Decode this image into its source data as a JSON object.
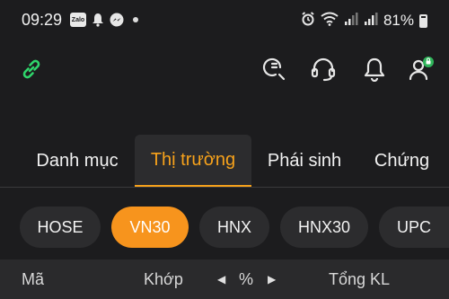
{
  "status_bar": {
    "time": "09:29",
    "zalo_label": "Zalo",
    "battery": "81%"
  },
  "tabs": [
    {
      "label": "Danh mục",
      "active": false
    },
    {
      "label": "Thị trường",
      "active": true
    },
    {
      "label": "Phái sinh",
      "active": false
    },
    {
      "label": "Chứng",
      "active": false
    }
  ],
  "exchanges": [
    {
      "label": "HOSE",
      "active": false
    },
    {
      "label": "VN30",
      "active": true
    },
    {
      "label": "HNX",
      "active": false
    },
    {
      "label": "HNX30",
      "active": false
    },
    {
      "label": "UPC",
      "active": false
    }
  ],
  "table_header": {
    "code": "Mã",
    "match": "Khớp",
    "percent": "%",
    "total_volume": "Tổng KL"
  },
  "colors": {
    "accent": "#f7941d",
    "link_icon": "#2fd66b",
    "background": "#1c1c1e"
  },
  "icons": [
    "link-icon",
    "search-history-icon",
    "support-headset-icon",
    "notification-bell-icon",
    "account-icon"
  ]
}
